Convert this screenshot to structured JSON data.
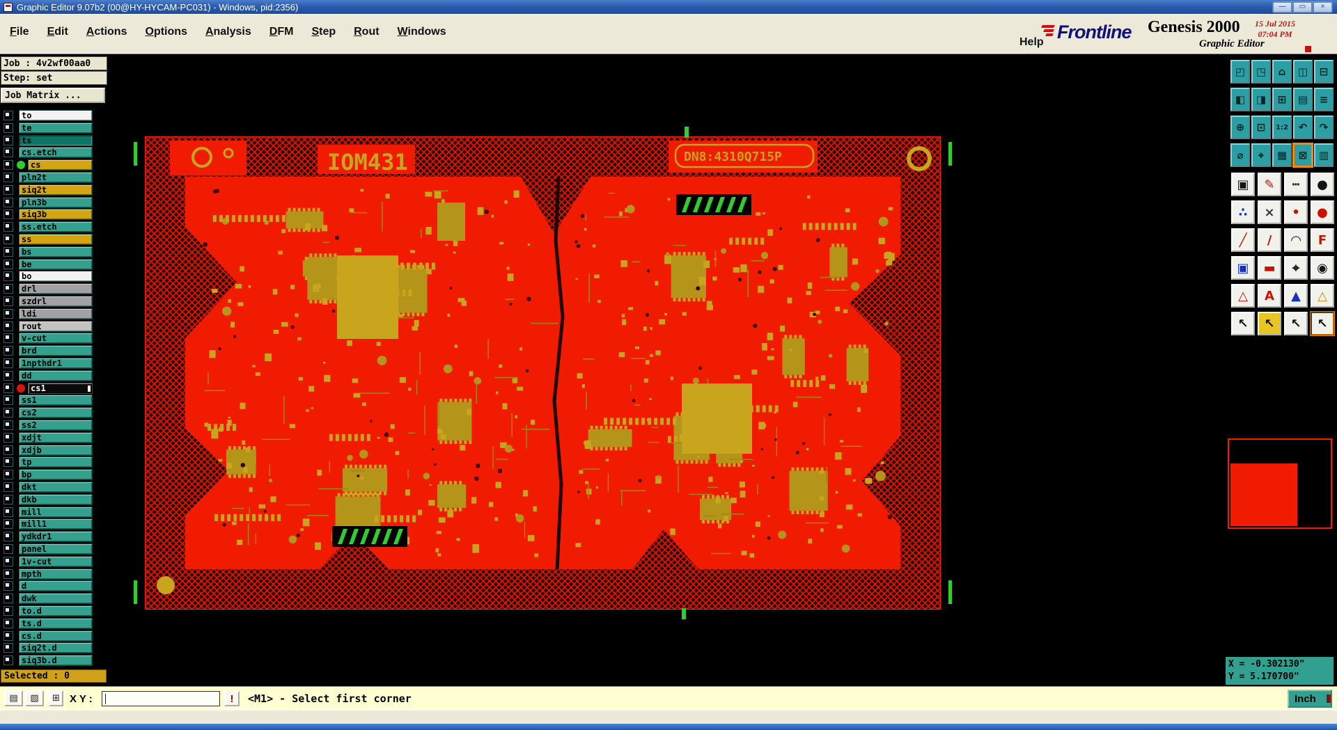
{
  "window": {
    "title": "Graphic Editor 9.07b2 (00@HY-HYCAM-PC031) - Windows, pid:2356)",
    "minimize_glyph": "—",
    "maximize_glyph": "▭",
    "close_glyph": "×"
  },
  "menu_bar": {
    "menus": [
      "File",
      "Edit",
      "Actions",
      "Options",
      "Analysis",
      "DFM",
      "Step",
      "Rout",
      "Windows"
    ],
    "help": "Help"
  },
  "branding": {
    "logo": "Frontline",
    "product": "Genesis 2000",
    "date": "15 Jul 2015",
    "time": "07:04 PM",
    "subtitle": "Graphic Editor"
  },
  "left_panel": {
    "job_label": "Job : 4v2wf00aa0",
    "step_label": "Step: set",
    "job_matrix_label": "Job Matrix ...",
    "selected_label": "Selected : 0",
    "layers": [
      {
        "name": "to",
        "style": "white"
      },
      {
        "name": "te",
        "style": "teal"
      },
      {
        "name": "ts",
        "style": "teal-dark"
      },
      {
        "name": "cs.etch",
        "style": "teal"
      },
      {
        "name": "cs",
        "style": "yellow",
        "dot": "green"
      },
      {
        "name": "pln2t",
        "style": "teal"
      },
      {
        "name": "siq2t",
        "style": "yellow"
      },
      {
        "name": "pln3b",
        "style": "teal"
      },
      {
        "name": "siq3b",
        "style": "yellow"
      },
      {
        "name": "ss.etch",
        "style": "teal"
      },
      {
        "name": "ss",
        "style": "yellow"
      },
      {
        "name": "bs",
        "style": "teal"
      },
      {
        "name": "be",
        "style": "teal"
      },
      {
        "name": "bo",
        "style": "white"
      },
      {
        "name": "drl",
        "style": "gray"
      },
      {
        "name": "szdrl",
        "style": "gray"
      },
      {
        "name": "ldi",
        "style": "gray"
      },
      {
        "name": "rout",
        "style": "gray-light"
      },
      {
        "name": "v-cut",
        "style": "teal"
      },
      {
        "name": "brd",
        "style": "teal"
      },
      {
        "name": "1npthdr1",
        "style": "teal"
      },
      {
        "name": "dd",
        "style": "teal"
      },
      {
        "name": "cs1",
        "style": "black",
        "dot": "red"
      },
      {
        "name": "ss1",
        "style": "teal"
      },
      {
        "name": "cs2",
        "style": "teal"
      },
      {
        "name": "ss2",
        "style": "teal"
      },
      {
        "name": "xdjt",
        "style": "teal"
      },
      {
        "name": "xdjb",
        "style": "teal"
      },
      {
        "name": "tp",
        "style": "teal"
      },
      {
        "name": "bp",
        "style": "teal"
      },
      {
        "name": "dkt",
        "style": "teal"
      },
      {
        "name": "dkb",
        "style": "teal"
      },
      {
        "name": "mill",
        "style": "teal"
      },
      {
        "name": "mill1",
        "style": "teal"
      },
      {
        "name": "ydkdr1",
        "style": "teal"
      },
      {
        "name": "panel",
        "style": "teal"
      },
      {
        "name": "1v-cut",
        "style": "teal"
      },
      {
        "name": "mpth",
        "style": "teal"
      },
      {
        "name": "d",
        "style": "teal"
      },
      {
        "name": "dwk",
        "style": "teal"
      },
      {
        "name": "to.d",
        "style": "teal"
      },
      {
        "name": "ts.d",
        "style": "teal"
      },
      {
        "name": "cs.d",
        "style": "teal"
      },
      {
        "name": "siq2t.d",
        "style": "teal"
      },
      {
        "name": "siq3b.d",
        "style": "teal"
      }
    ]
  },
  "board": {
    "title": "IOM431",
    "serial": "DN8:4310Q715P"
  },
  "toolbar": {
    "teal": [
      {
        "name": "zoom-window",
        "glyph": "◰"
      },
      {
        "name": "zoom-view",
        "glyph": "◳"
      },
      {
        "name": "home-view",
        "glyph": "⌂"
      },
      {
        "name": "cascade-windows",
        "glyph": "◫"
      },
      {
        "name": "tile-windows",
        "glyph": "⊟"
      },
      {
        "name": "prev-window",
        "glyph": "◧"
      },
      {
        "name": "next-window",
        "glyph": "◨"
      },
      {
        "name": "zoom-all",
        "glyph": "⊞"
      },
      {
        "name": "layer-table",
        "glyph": "▤"
      },
      {
        "name": "list-view",
        "glyph": "≡"
      },
      {
        "name": "center-view",
        "glyph": "⊕"
      },
      {
        "name": "fit-view",
        "glyph": "⊡"
      },
      {
        "name": "scale-1-2",
        "glyph": "1:2"
      },
      {
        "name": "undo-view",
        "glyph": "↶"
      },
      {
        "name": "redo-view",
        "glyph": "↷"
      },
      {
        "name": "measure-circle",
        "glyph": "⌀"
      },
      {
        "name": "target-point",
        "glyph": "⌖"
      },
      {
        "name": "grid-display",
        "glyph": "▦"
      },
      {
        "name": "snap-grid",
        "glyph": "⊠",
        "active": true
      },
      {
        "name": "pattern-fill",
        "glyph": "▥"
      }
    ],
    "white": [
      {
        "name": "outline-tool",
        "glyph": "▣",
        "color": "#141414"
      },
      {
        "name": "sketch-tool",
        "glyph": "✎",
        "color": "#cc1100"
      },
      {
        "name": "dashed-line-tool",
        "glyph": "┅",
        "color": "#141414"
      },
      {
        "name": "filled-circle-tool",
        "glyph": "●",
        "color": "#141414"
      },
      {
        "name": "scatter-tool",
        "glyph": "∴",
        "color": "#1133bb"
      },
      {
        "name": "delete-tool",
        "glyph": "×",
        "color": "#333344"
      },
      {
        "name": "small-pad-tool",
        "glyph": "•",
        "color": "#cc1100"
      },
      {
        "name": "dot-pad-tool",
        "glyph": "●",
        "color": "#cc1100"
      },
      {
        "name": "line-tool",
        "glyph": "╱",
        "color": "#cc1100"
      },
      {
        "name": "thin-line-tool",
        "glyph": "/",
        "color": "#cc1100"
      },
      {
        "name": "arc-tool",
        "glyph": "◠",
        "color": "#141414"
      },
      {
        "name": "mirror-text-tool",
        "glyph": "F",
        "color": "#cc1100"
      },
      {
        "name": "pad-frame-tool",
        "glyph": "▣",
        "color": "#1133bb"
      },
      {
        "name": "bar-tool",
        "glyph": "▬",
        "color": "#cc1100"
      },
      {
        "name": "crosshair-tool",
        "glyph": "⌖",
        "color": "#141414"
      },
      {
        "name": "spiral-tool",
        "glyph": "◉",
        "color": "#141414"
      },
      {
        "name": "triangle-outline-tool",
        "glyph": "△",
        "color": "#cc1100"
      },
      {
        "name": "triangle-a-tool",
        "glyph": "A",
        "color": "#cc1100"
      },
      {
        "name": "triangle-filled-tool",
        "glyph": "▲",
        "color": "#1133bb"
      },
      {
        "name": "triangle-alert-tool",
        "glyph": "△",
        "color": "#cc8800"
      },
      {
        "name": "select-cursor-tool",
        "glyph": "↖",
        "color": "#141414"
      },
      {
        "name": "pick-cursor-tool",
        "glyph": "↖",
        "color": "#141414",
        "bg": "#e8c520"
      },
      {
        "name": "query-cursor-tool",
        "glyph": "↖",
        "color": "#141414"
      },
      {
        "name": "active-cursor-tool",
        "glyph": "↖",
        "color": "#141414",
        "active": true
      }
    ]
  },
  "readout": {
    "x": "X = -0.302130\"",
    "y": "Y = 5.170700\""
  },
  "status_bar": {
    "buttons": [
      {
        "name": "capture-page-button",
        "glyph": "▤"
      },
      {
        "name": "overlay-page-button",
        "glyph": "▧"
      },
      {
        "name": "grid-toggle-button",
        "glyph": "⊞"
      }
    ],
    "xy_label": "X Y :",
    "input_value": "",
    "alert_label": "!",
    "message": "<M1> - Select first corner",
    "units": "Inch"
  },
  "colors": {
    "board_red": "#f01b00",
    "component_olive": "#c9a51d",
    "panel_teal": "#35a08e",
    "layer_yellow": "#d4a513",
    "marker_green": "#33cc33",
    "chrome_cream": "#ece9d8",
    "statusbar_yellow": "#ffffd2"
  }
}
